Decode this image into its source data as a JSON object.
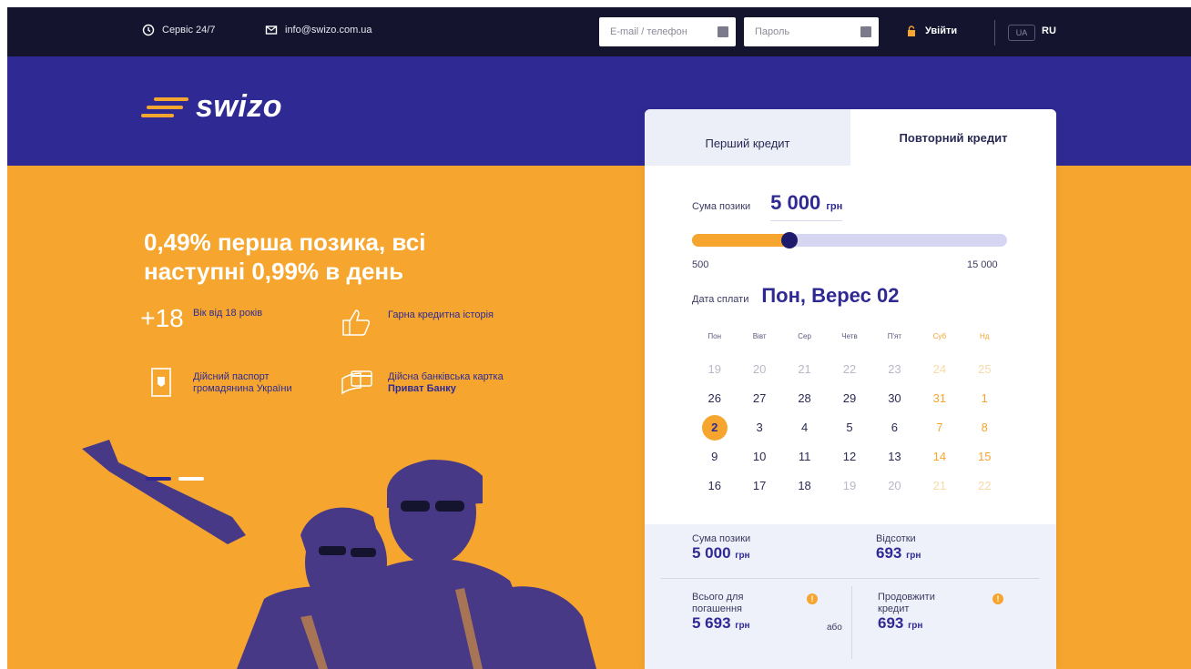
{
  "topbar": {
    "service": "Сервіс 24/7",
    "email": "info@swizo.com.ua",
    "login_placeholder": "E-mail / телефон",
    "password_placeholder": "Пароль",
    "enter_label": "Увійти",
    "lang_ua": "UA",
    "lang_ru": "RU"
  },
  "brand": {
    "name": "swizo"
  },
  "hero": {
    "headline": "0,49% перша позика, всі наступні 0,99% в день",
    "requirements": [
      {
        "icon": "age-18-icon",
        "text": "Вік від 18 років"
      },
      {
        "icon": "thumbs-up-icon",
        "text": "Гарна кредитна історія"
      },
      {
        "icon": "passport-icon",
        "text": "Дійсний паспорт громадянина України"
      },
      {
        "icon": "bank-card-icon",
        "text": "Дійсна банківська картка",
        "bold": "Приват Банку"
      }
    ],
    "age_glyph": "+18",
    "slide_active": 1
  },
  "calculator": {
    "tab_first": "Перший кредит",
    "tab_repeat": "Повторний кредит",
    "amount_label": "Сума позики",
    "amount_value": "5 000",
    "currency": "грн",
    "slider_min": "500",
    "slider_max": "15 000",
    "slider_fraction": 0.31,
    "date_label": "Дата сплати",
    "date_value": "Пон, Верес 02",
    "weekdays": [
      "Пон",
      "Вівт",
      "Сер",
      "Четв",
      "П'ят",
      "Суб",
      "Нд"
    ],
    "weeks": [
      [
        {
          "d": "19",
          "m": true
        },
        {
          "d": "20",
          "m": true
        },
        {
          "d": "21",
          "m": true
        },
        {
          "d": "22",
          "m": true
        },
        {
          "d": "23",
          "m": true
        },
        {
          "d": "24",
          "m": true
        },
        {
          "d": "25",
          "m": true
        }
      ],
      [
        {
          "d": "26"
        },
        {
          "d": "27"
        },
        {
          "d": "28"
        },
        {
          "d": "29"
        },
        {
          "d": "30"
        },
        {
          "d": "31"
        },
        {
          "d": "1"
        }
      ],
      [
        {
          "d": "2",
          "s": true
        },
        {
          "d": "3"
        },
        {
          "d": "4"
        },
        {
          "d": "5"
        },
        {
          "d": "6"
        },
        {
          "d": "7"
        },
        {
          "d": "8"
        }
      ],
      [
        {
          "d": "9"
        },
        {
          "d": "10"
        },
        {
          "d": "11"
        },
        {
          "d": "12"
        },
        {
          "d": "13"
        },
        {
          "d": "14"
        },
        {
          "d": "15"
        }
      ],
      [
        {
          "d": "16"
        },
        {
          "d": "17"
        },
        {
          "d": "18"
        },
        {
          "d": "19",
          "m": true
        },
        {
          "d": "20",
          "m": true
        },
        {
          "d": "21",
          "m": true
        },
        {
          "d": "22",
          "m": true
        }
      ]
    ]
  },
  "summary": {
    "loan_label": "Сума позики",
    "loan_value": "5 000",
    "interest_label": "Відсотки",
    "interest_value": "693",
    "total_label": "Всього для погашення",
    "total_value": "5 693",
    "or": "або",
    "extend_label": "Продовжити кредит",
    "extend_value": "693",
    "currency": "грн"
  },
  "colors": {
    "navy": "#14142f",
    "blue": "#2f2a93",
    "orange": "#f6a62f"
  }
}
